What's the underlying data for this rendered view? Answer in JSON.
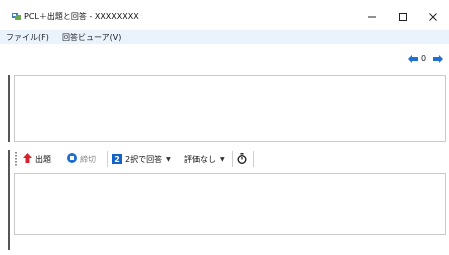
{
  "window": {
    "title": "PCL＋出題と回答 - XXXXXXXX",
    "controls": {
      "minimize": "—",
      "maximize": "☐",
      "close": "✕"
    }
  },
  "menu": {
    "items": [
      "ファイル(F)",
      "回答ビューア(V)"
    ]
  },
  "navigation": {
    "count": "0"
  },
  "toolbar": {
    "ask_label": "出題",
    "deadline_label": "締切",
    "answer_mode_badge": "2",
    "answer_mode_label": "2択で回答",
    "rating_label": "評価なし"
  },
  "icons": {
    "app": "app-icon",
    "nav_back": "arrow-left-icon",
    "nav_forward": "arrow-right-icon",
    "ask": "red-up-arrow-icon",
    "deadline": "blue-stop-icon",
    "timer": "stopwatch-icon"
  },
  "colors": {
    "menubar_bg": "#eaf2fb",
    "nav_arrow": "#1f6fd0",
    "ask_icon": "#d6232d",
    "accent_blue": "#1463c4"
  }
}
